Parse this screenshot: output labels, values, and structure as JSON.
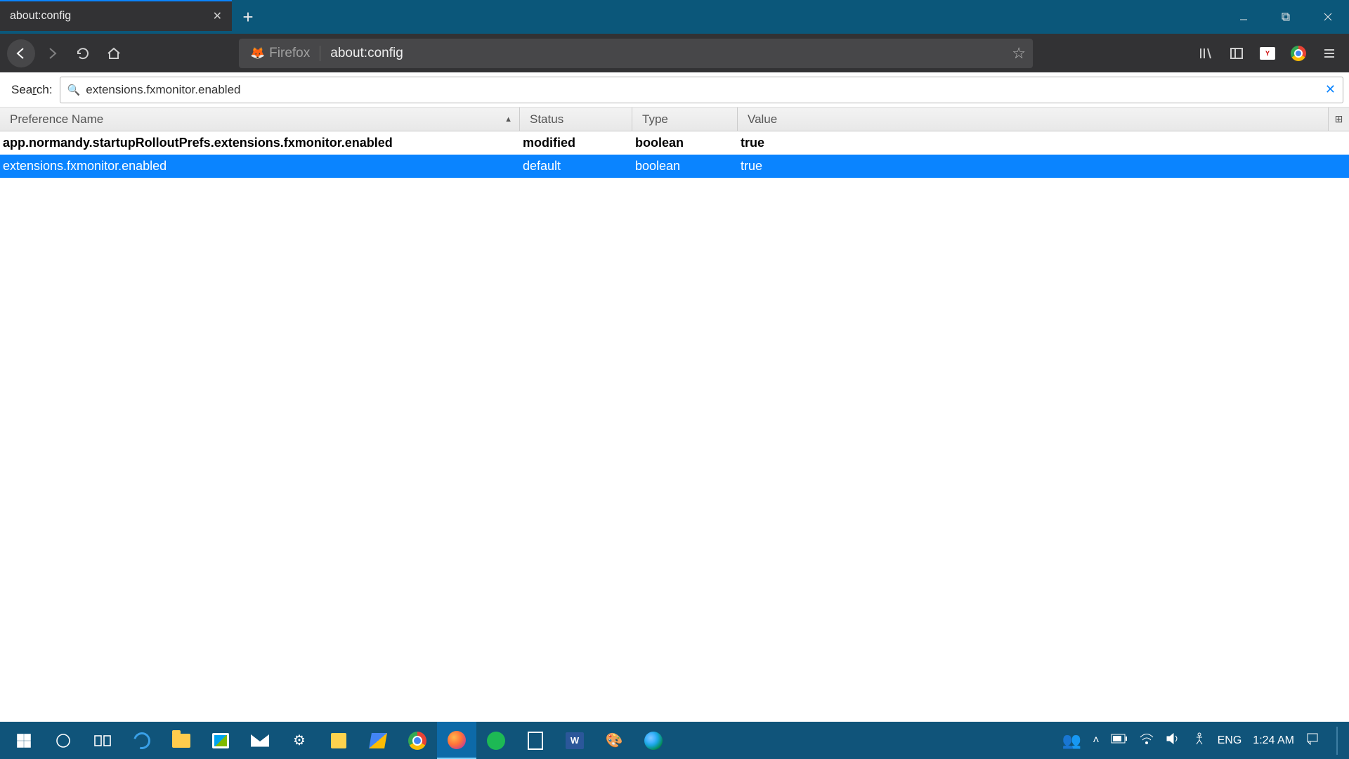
{
  "tab": {
    "title": "about:config"
  },
  "urlbar": {
    "brand": "Firefox",
    "address": "about:config"
  },
  "search": {
    "label_pre": "Sea",
    "label_ul": "r",
    "label_post": "ch:",
    "value": "extensions.fxmonitor.enabled"
  },
  "columns": {
    "name": "Preference Name",
    "status": "Status",
    "type": "Type",
    "value": "Value"
  },
  "rows": [
    {
      "name": "app.normandy.startupRolloutPrefs.extensions.fxmonitor.enabled",
      "status": "modified",
      "type": "boolean",
      "value": "true",
      "bold": true,
      "selected": false
    },
    {
      "name": "extensions.fxmonitor.enabled",
      "status": "default",
      "type": "boolean",
      "value": "true",
      "bold": false,
      "selected": true
    }
  ],
  "tray": {
    "lang": "ENG",
    "time": "1:24 AM"
  },
  "word_label": "W"
}
